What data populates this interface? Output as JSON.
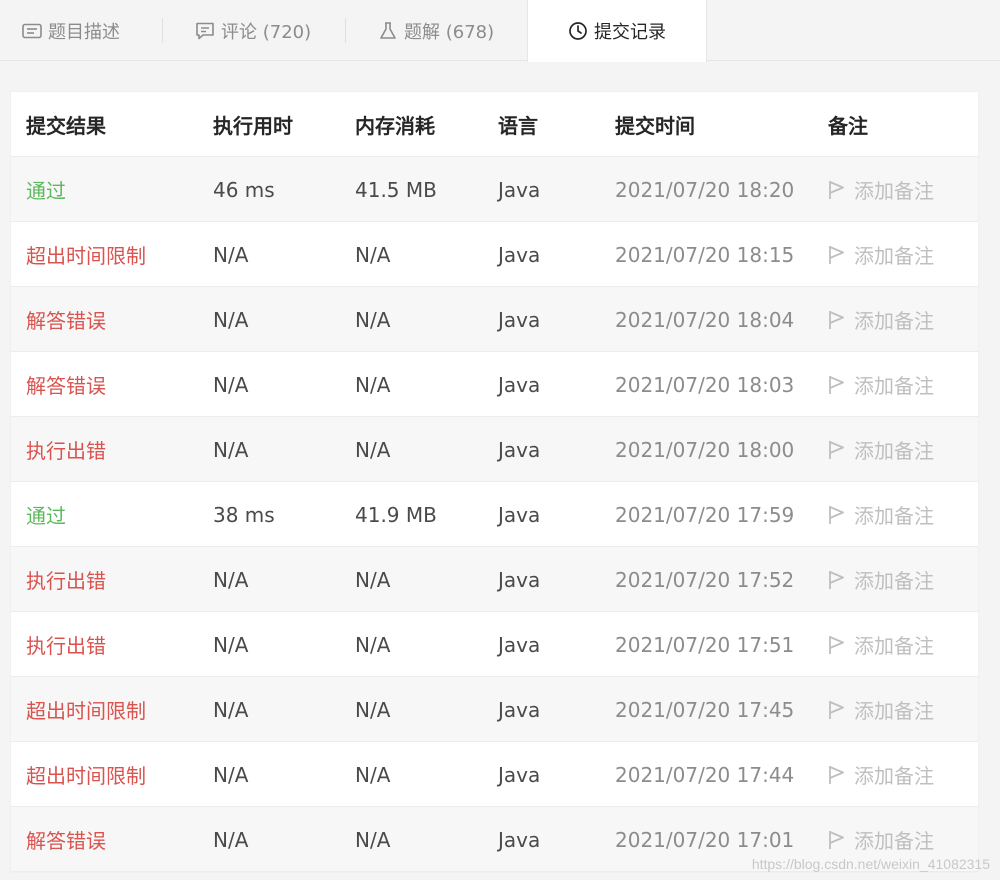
{
  "tabs": [
    {
      "label": "题目描述",
      "icon": "description-icon"
    },
    {
      "label": "评论 (720)",
      "icon": "comment-icon"
    },
    {
      "label": "题解 (678)",
      "icon": "flask-icon"
    },
    {
      "label": "提交记录",
      "icon": "clock-icon",
      "active": true
    }
  ],
  "table": {
    "headers": [
      "提交结果",
      "执行用时",
      "内存消耗",
      "语言",
      "提交时间",
      "备注"
    ],
    "note_label": "添加备注",
    "rows": [
      {
        "status": "通过",
        "status_type": "pass",
        "runtime": "46 ms",
        "memory": "41.5 MB",
        "lang": "Java",
        "time": "2021/07/20 18:20"
      },
      {
        "status": "超出时间限制",
        "status_type": "fail",
        "runtime": "N/A",
        "memory": "N/A",
        "lang": "Java",
        "time": "2021/07/20 18:15"
      },
      {
        "status": "解答错误",
        "status_type": "fail",
        "runtime": "N/A",
        "memory": "N/A",
        "lang": "Java",
        "time": "2021/07/20 18:04"
      },
      {
        "status": "解答错误",
        "status_type": "fail",
        "runtime": "N/A",
        "memory": "N/A",
        "lang": "Java",
        "time": "2021/07/20 18:03"
      },
      {
        "status": "执行出错",
        "status_type": "fail",
        "runtime": "N/A",
        "memory": "N/A",
        "lang": "Java",
        "time": "2021/07/20 18:00"
      },
      {
        "status": "通过",
        "status_type": "pass",
        "runtime": "38 ms",
        "memory": "41.9 MB",
        "lang": "Java",
        "time": "2021/07/20 17:59"
      },
      {
        "status": "执行出错",
        "status_type": "fail",
        "runtime": "N/A",
        "memory": "N/A",
        "lang": "Java",
        "time": "2021/07/20 17:52"
      },
      {
        "status": "执行出错",
        "status_type": "fail",
        "runtime": "N/A",
        "memory": "N/A",
        "lang": "Java",
        "time": "2021/07/20 17:51"
      },
      {
        "status": "超出时间限制",
        "status_type": "fail",
        "runtime": "N/A",
        "memory": "N/A",
        "lang": "Java",
        "time": "2021/07/20 17:45"
      },
      {
        "status": "超出时间限制",
        "status_type": "fail",
        "runtime": "N/A",
        "memory": "N/A",
        "lang": "Java",
        "time": "2021/07/20 17:44"
      },
      {
        "status": "解答错误",
        "status_type": "fail",
        "runtime": "N/A",
        "memory": "N/A",
        "lang": "Java",
        "time": "2021/07/20 17:01"
      }
    ]
  },
  "watermark": "https://blog.csdn.net/weixin_41082315",
  "colors": {
    "pass": "#5cb85c",
    "fail": "#d9534f",
    "muted": "#8c8c8c",
    "note": "#bfbfbf"
  }
}
